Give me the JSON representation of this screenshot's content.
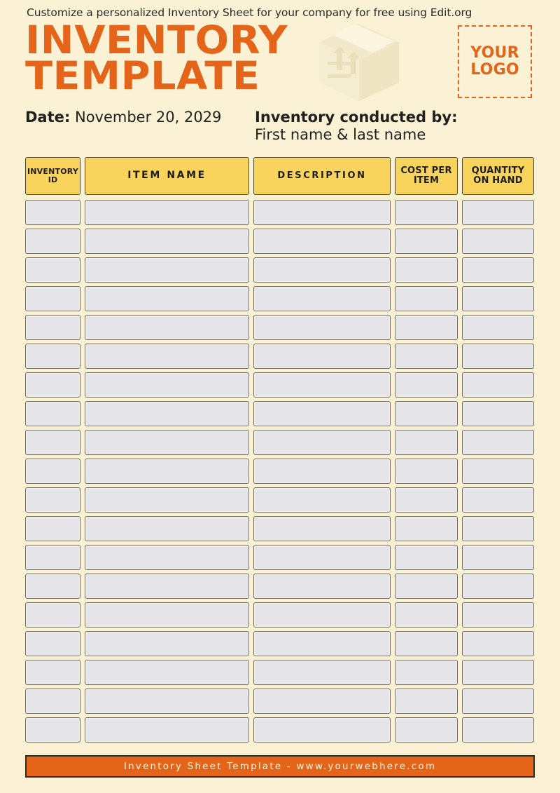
{
  "document": {
    "tagline": "Customize a personalized Inventory Sheet for your company for free using Edit.org",
    "title_line1": "INVENTORY",
    "title_line2": "TEMPLATE",
    "logo_line1": "YOUR",
    "logo_line2": "LOGO",
    "date_label": "Date:",
    "date_value": "November 20, 2029",
    "conducted_by_label": "Inventory conducted by:",
    "conducted_by_value": "First name & last name",
    "footer_text": "Inventory Sheet Template - www.yourwebhere.com"
  },
  "colors": {
    "background": "#fbf2d5",
    "accent_orange": "#e4641a",
    "header_yellow": "#f9d45c",
    "cell_gray": "#e4e4e9",
    "border_dark": "#4b4733",
    "text_dark": "#1f1f1c"
  },
  "icons": {
    "package": "package-box-icon",
    "arrow_up": "arrow-up-icon"
  },
  "table": {
    "columns": [
      {
        "key": "inventory_id",
        "label": "INVENTORY\nID",
        "label_line1": "INVENTORY",
        "label_line2": "ID"
      },
      {
        "key": "item_name",
        "label": "ITEM NAME"
      },
      {
        "key": "description",
        "label": "DESCRIPTION"
      },
      {
        "key": "cost_per_item",
        "label": "COST PER\nITEM",
        "label_line1": "COST PER",
        "label_line2": "ITEM"
      },
      {
        "key": "quantity_on_hand",
        "label": "QUANTITY\nON HAND",
        "label_line1": "QUANTITY",
        "label_line2": "ON HAND"
      }
    ],
    "row_count": 19,
    "rows": [
      {
        "inventory_id": "",
        "item_name": "",
        "description": "",
        "cost_per_item": "",
        "quantity_on_hand": ""
      },
      {
        "inventory_id": "",
        "item_name": "",
        "description": "",
        "cost_per_item": "",
        "quantity_on_hand": ""
      },
      {
        "inventory_id": "",
        "item_name": "",
        "description": "",
        "cost_per_item": "",
        "quantity_on_hand": ""
      },
      {
        "inventory_id": "",
        "item_name": "",
        "description": "",
        "cost_per_item": "",
        "quantity_on_hand": ""
      },
      {
        "inventory_id": "",
        "item_name": "",
        "description": "",
        "cost_per_item": "",
        "quantity_on_hand": ""
      },
      {
        "inventory_id": "",
        "item_name": "",
        "description": "",
        "cost_per_item": "",
        "quantity_on_hand": ""
      },
      {
        "inventory_id": "",
        "item_name": "",
        "description": "",
        "cost_per_item": "",
        "quantity_on_hand": ""
      },
      {
        "inventory_id": "",
        "item_name": "",
        "description": "",
        "cost_per_item": "",
        "quantity_on_hand": ""
      },
      {
        "inventory_id": "",
        "item_name": "",
        "description": "",
        "cost_per_item": "",
        "quantity_on_hand": ""
      },
      {
        "inventory_id": "",
        "item_name": "",
        "description": "",
        "cost_per_item": "",
        "quantity_on_hand": ""
      },
      {
        "inventory_id": "",
        "item_name": "",
        "description": "",
        "cost_per_item": "",
        "quantity_on_hand": ""
      },
      {
        "inventory_id": "",
        "item_name": "",
        "description": "",
        "cost_per_item": "",
        "quantity_on_hand": ""
      },
      {
        "inventory_id": "",
        "item_name": "",
        "description": "",
        "cost_per_item": "",
        "quantity_on_hand": ""
      },
      {
        "inventory_id": "",
        "item_name": "",
        "description": "",
        "cost_per_item": "",
        "quantity_on_hand": ""
      },
      {
        "inventory_id": "",
        "item_name": "",
        "description": "",
        "cost_per_item": "",
        "quantity_on_hand": ""
      },
      {
        "inventory_id": "",
        "item_name": "",
        "description": "",
        "cost_per_item": "",
        "quantity_on_hand": ""
      },
      {
        "inventory_id": "",
        "item_name": "",
        "description": "",
        "cost_per_item": "",
        "quantity_on_hand": ""
      },
      {
        "inventory_id": "",
        "item_name": "",
        "description": "",
        "cost_per_item": "",
        "quantity_on_hand": ""
      },
      {
        "inventory_id": "",
        "item_name": "",
        "description": "",
        "cost_per_item": "",
        "quantity_on_hand": ""
      }
    ]
  }
}
